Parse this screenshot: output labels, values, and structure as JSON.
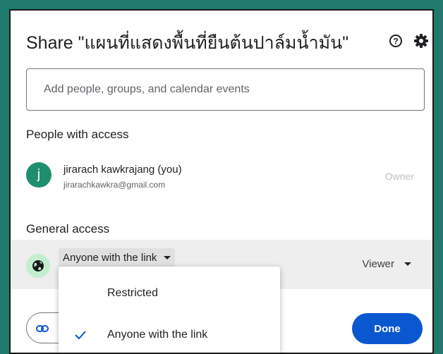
{
  "dialog": {
    "title": "Share \"แผนที่แสดงพื้นที่ยืนต้นปาล์มน้ำมัน\"",
    "help_icon": "help-circle-icon",
    "settings_icon": "gear-icon"
  },
  "add_people": {
    "placeholder": "Add people, groups, and calendar events"
  },
  "people_with_access": {
    "label": "People with access",
    "user": {
      "avatar_letter": "j",
      "name": "jirarach kawkrajang (you)",
      "email": "jirarachkawkra@gmail.com",
      "role": "Owner",
      "avatar_color": "#1e8e6e"
    }
  },
  "general_access": {
    "label": "General access",
    "selected": "Anyone with the link",
    "role": "Viewer",
    "icon": "globe-icon"
  },
  "dropdown": {
    "items": [
      {
        "label": "Restricted",
        "checked": false
      },
      {
        "label": "Anyone with the link",
        "checked": true
      }
    ]
  },
  "footer": {
    "copy_link_icon": "link-icon",
    "done_label": "Done",
    "accent_color": "#0b57d0"
  }
}
